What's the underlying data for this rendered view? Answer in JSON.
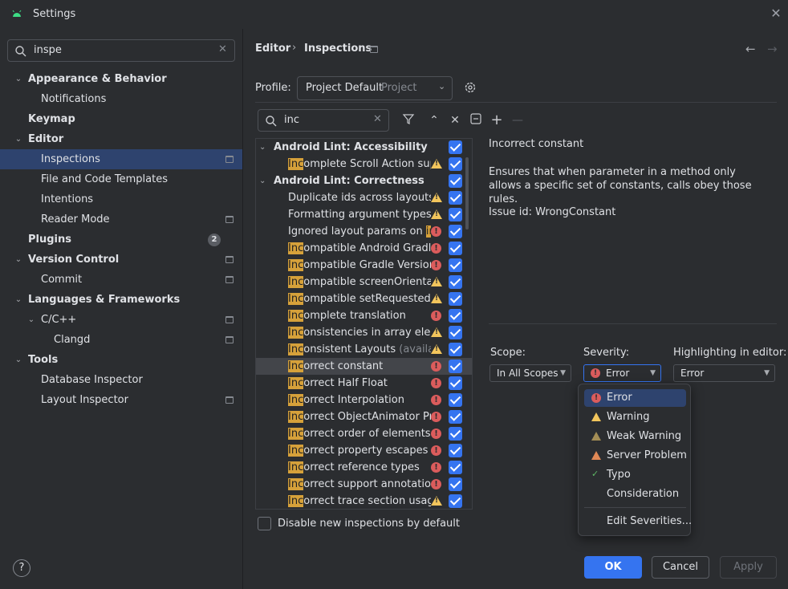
{
  "window": {
    "title": "Settings"
  },
  "sidebar": {
    "search_value": "inspe",
    "items": [
      {
        "label": "Appearance & Behavior",
        "bold": true
      },
      {
        "label": "Notifications",
        "bold": false
      },
      {
        "label": "Keymap",
        "bold": true
      },
      {
        "label": "Editor",
        "bold": true
      },
      {
        "label": "Inspections",
        "bold": false
      },
      {
        "label": "File and Code Templates",
        "bold": false
      },
      {
        "label": "Intentions",
        "bold": false
      },
      {
        "label": "Reader Mode",
        "bold": false
      },
      {
        "label": "Plugins",
        "bold": true,
        "badge": "2"
      },
      {
        "label": "Version Control",
        "bold": true
      },
      {
        "label": "Commit",
        "bold": false
      },
      {
        "label": "Languages & Frameworks",
        "bold": true
      },
      {
        "label": "C/C++",
        "bold": false
      },
      {
        "label": "Clangd",
        "bold": false
      },
      {
        "label": "Tools",
        "bold": true
      },
      {
        "label": "Database Inspector",
        "bold": false
      },
      {
        "label": "Layout Inspector",
        "bold": false
      }
    ],
    "help_label": "?"
  },
  "breadcrumb": {
    "parent": "Editor",
    "separator": "›",
    "current": "Inspections"
  },
  "profile": {
    "label": "Profile:",
    "value": "Project Default",
    "type": "Project"
  },
  "filter": {
    "value": "inc"
  },
  "inspections": [
    {
      "group": true,
      "label": "Android Lint: Accessibility"
    },
    {
      "hl": "Inc",
      "rest": "omplete Scroll Action supp",
      "severity": "warning"
    },
    {
      "group": true,
      "label": "Android Lint: Correctness"
    },
    {
      "pre": "Duplicate ids across layouts c",
      "severity": "warning"
    },
    {
      "pre": "Formatting argument types ",
      "hl": "in",
      "severity": "warning"
    },
    {
      "pre": "Ignored layout params on ",
      "hl": "inc",
      "severity": "error"
    },
    {
      "hl": "Inc",
      "rest": "ompatible Android Gradle",
      "severity": "error"
    },
    {
      "hl": "Inc",
      "rest": "ompatible Gradle Versions",
      "severity": "error"
    },
    {
      "hl": "Inc",
      "rest": "ompatible screenOrientatic",
      "severity": "warning"
    },
    {
      "hl": "Inc",
      "rest": "ompatible setRequestedOr",
      "severity": "warning"
    },
    {
      "hl": "Inc",
      "rest": "omplete translation",
      "severity": "error"
    },
    {
      "hl": "Inc",
      "rest": "onsistencies in array eleme",
      "severity": "warning"
    },
    {
      "hl": "Inc",
      "rest": "onsistent Layouts ",
      "dim": "(available",
      "severity": "warning"
    },
    {
      "hl": "Inc",
      "rest": "orrect constant",
      "severity": "error",
      "selected": true
    },
    {
      "hl": "Inc",
      "rest": "orrect Half Float",
      "severity": "error"
    },
    {
      "hl": "Inc",
      "rest": "orrect Interpolation",
      "severity": "error"
    },
    {
      "hl": "Inc",
      "rest": "orrect ObjectAnimator Prop",
      "severity": "error"
    },
    {
      "hl": "Inc",
      "rest": "orrect order of elements in",
      "severity": "error"
    },
    {
      "hl": "Inc",
      "rest": "orrect property escapes",
      "severity": "error"
    },
    {
      "hl": "Inc",
      "rest": "orrect reference types",
      "severity": "error"
    },
    {
      "hl": "Inc",
      "rest": "orrect support annotation u",
      "severity": "error"
    },
    {
      "hl": "Inc",
      "rest": "orrect trace section usage",
      "severity": "warning"
    }
  ],
  "disable_new_label": "Disable new inspections by default",
  "description": {
    "title": "Incorrect constant",
    "body": "Ensures that when parameter in a method only allows a specific set of constants, calls obey those rules.",
    "issue": "Issue id: WrongConstant"
  },
  "options": {
    "scope_label": "Scope:",
    "scope_value": "In All Scopes",
    "severity_label": "Severity:",
    "severity_value": "Error",
    "highlight_label": "Highlighting in editor:",
    "highlight_value": "Error"
  },
  "severity_popup": {
    "items": [
      {
        "label": "Error",
        "icon": "error-icon",
        "selected": true
      },
      {
        "label": "Warning",
        "icon": "warning-icon"
      },
      {
        "label": "Weak Warning",
        "icon": "weak-warning-icon"
      },
      {
        "label": "Server Problem",
        "icon": "server-problem-icon"
      },
      {
        "label": "Typo",
        "icon": "typo-icon"
      },
      {
        "label": "Consideration",
        "icon": ""
      }
    ],
    "edit_label": "Edit Severities..."
  },
  "buttons": {
    "ok": "OK",
    "cancel": "Cancel",
    "apply": "Apply"
  },
  "colors": {
    "accent": "#3574f0",
    "error": "#db5c5c",
    "warning": "#f2c55c",
    "highlight": "#d6a13a"
  }
}
